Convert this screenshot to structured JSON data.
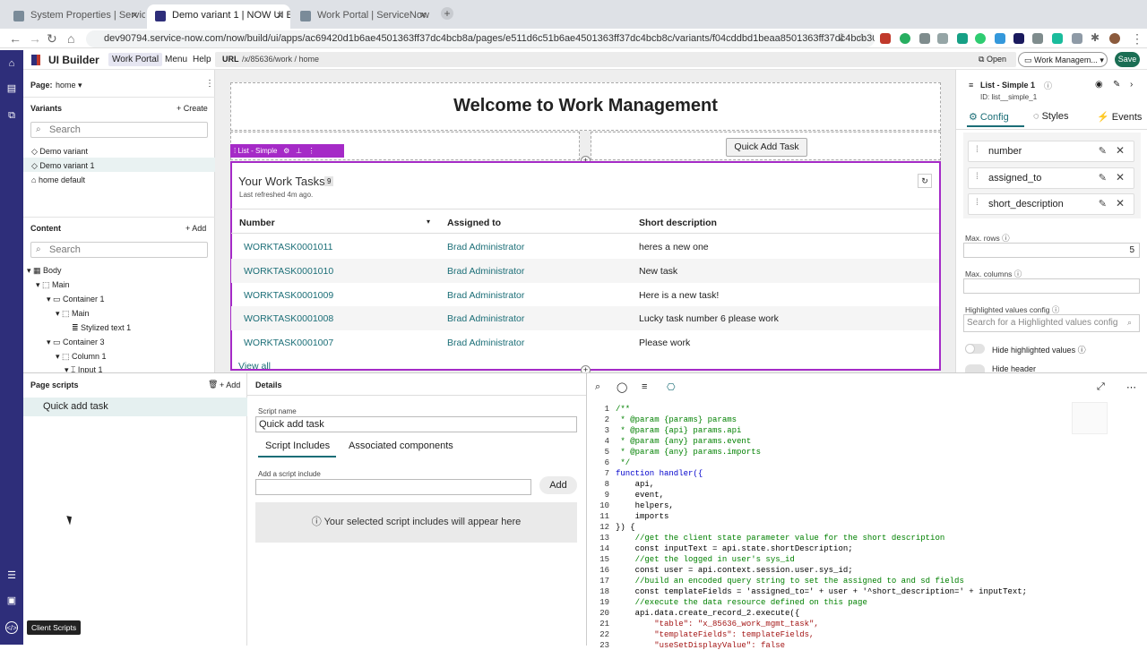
{
  "browser": {
    "tabs": [
      {
        "title": "System Properties | ServiceNow",
        "active": false
      },
      {
        "title": "Demo variant 1 | NOW UI Builder",
        "active": true
      },
      {
        "title": "Work Portal | ServiceNow",
        "active": false
      }
    ],
    "url": "dev90794.service-now.com/now/build/ui/apps/ac69420d1b6ae4501363ff37dc4bcb8a/pages/e511d6c51b6ae4501363ff37dc4bcb8c/variants/f04cddbd1beaa8501363ff37dc4bcb30"
  },
  "header": {
    "app_name": "UI Builder",
    "experience": "Work Portal",
    "menu": "Menu",
    "help": "Help",
    "url_label": "URL",
    "url_value": "/x/85636/work / home",
    "open": "Open",
    "experience_select": "Work Managem...",
    "save": "Save"
  },
  "left": {
    "page_label": "Page:",
    "page_value": "home",
    "variants_label": "Variants",
    "create": "Create",
    "search_placeholder": "Search",
    "variants": [
      "Demo variant",
      "Demo variant 1",
      "home default"
    ],
    "content_label": "Content",
    "add": "Add",
    "tree": [
      "Body",
      "Main",
      "Container 1",
      "Main",
      "Stylized text 1",
      "Container 3",
      "Column 1",
      "Input 1"
    ]
  },
  "canvas": {
    "title": "Welcome to Work Management",
    "quick_add_button": "Quick Add Task",
    "list_tag": "List - Simple",
    "list_title": "Your Work Tasks",
    "list_count": "9",
    "refreshed": "Last refreshed 4m ago.",
    "columns": [
      "Number",
      "Assigned to",
      "Short description"
    ],
    "rows": [
      {
        "number": "WORKTASK0001011",
        "assigned": "Brad Administrator",
        "desc": "heres a new one"
      },
      {
        "number": "WORKTASK0001010",
        "assigned": "Brad Administrator",
        "desc": "New task"
      },
      {
        "number": "WORKTASK0001009",
        "assigned": "Brad Administrator",
        "desc": "Here is a new task!"
      },
      {
        "number": "WORKTASK0001008",
        "assigned": "Brad Administrator",
        "desc": "Lucky task number 6 please work"
      },
      {
        "number": "WORKTASK0001007",
        "assigned": "Brad Administrator",
        "desc": "Please work"
      }
    ],
    "view_all": "View all"
  },
  "right": {
    "component_name": "List - Simple 1",
    "component_id": "ID: list__simple_1",
    "tabs": [
      "Config",
      "Styles",
      "Events"
    ],
    "fields": [
      "number",
      "assigned_to",
      "short_description"
    ],
    "max_rows_label": "Max. rows",
    "max_rows_value": "5",
    "max_columns_label": "Max. columns",
    "highlighted_label": "Highlighted values config",
    "highlighted_placeholder": "Search for a Highlighted values config",
    "hide_highlighted": "Hide highlighted values",
    "hide_header": "Hide header"
  },
  "bottom": {
    "page_scripts": "Page scripts",
    "add": "Add",
    "script_item": "Quick add task",
    "details": "Details",
    "script_name_label": "Script name",
    "script_name_value": "Quick add task",
    "tabs": [
      "Script Includes",
      "Associated components"
    ],
    "add_include_label": "Add a script include",
    "add_button": "Add",
    "empty_msg": "Your selected script includes will appear here",
    "tooltip": "Client Scripts"
  },
  "code": [
    "/**",
    " * @param {params} params",
    " * @param {api} params.api",
    " * @param {any} params.event",
    " * @param {any} params.imports",
    " */",
    "function handler({",
    "    api,",
    "    event,",
    "    helpers,",
    "    imports",
    "}) {",
    "    //get the client state parameter value for the short description",
    "    const inputText = api.state.shortDescription;",
    "    //get the logged in user's sys_id",
    "    const user = api.context.session.user.sys_id;",
    "    //build an encoded query string to set the assigned to and sd fields",
    "    const templateFields = 'assigned_to=' + user + '^short_description=' + inputText;",
    "    //execute the data resource defined on this page",
    "    api.data.create_record_2.execute({",
    "        \"table\": \"x_85636_work_mgmt_task\",",
    "        \"templateFields\": templateFields,",
    "        \"useSetDisplayValue\": false"
  ],
  "colors": {
    "accent": "#2e2e7a",
    "link": "#1b6e77",
    "select": "#a52ac7",
    "save": "#1b6e54"
  }
}
